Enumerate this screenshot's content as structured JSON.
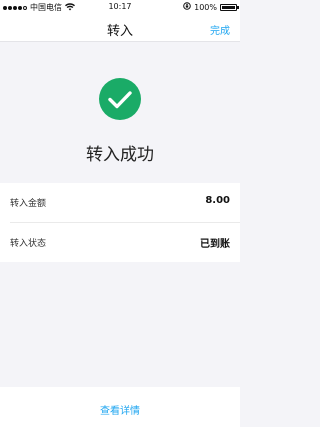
{
  "status_bar": {
    "carrier": "中国电信",
    "time": "10:17",
    "battery": "100%",
    "signal_icon": "signal-dots-icon",
    "wifi_icon": "wifi-icon",
    "lock_icon": "rotation-lock-icon",
    "battery_icon": "battery-icon"
  },
  "nav": {
    "title": "转入",
    "done_label": "完成"
  },
  "result": {
    "icon": "checkmark-circle-icon",
    "message": "转入成功"
  },
  "details": [
    {
      "label": "转入金额",
      "value": "8.00"
    },
    {
      "label": "转入状态",
      "value": "已到账"
    }
  ],
  "footer": {
    "link_label": "查看详情"
  },
  "colors": {
    "accent": "#1ea5f0",
    "success": "#1aab67",
    "background": "#f4f4f8"
  }
}
